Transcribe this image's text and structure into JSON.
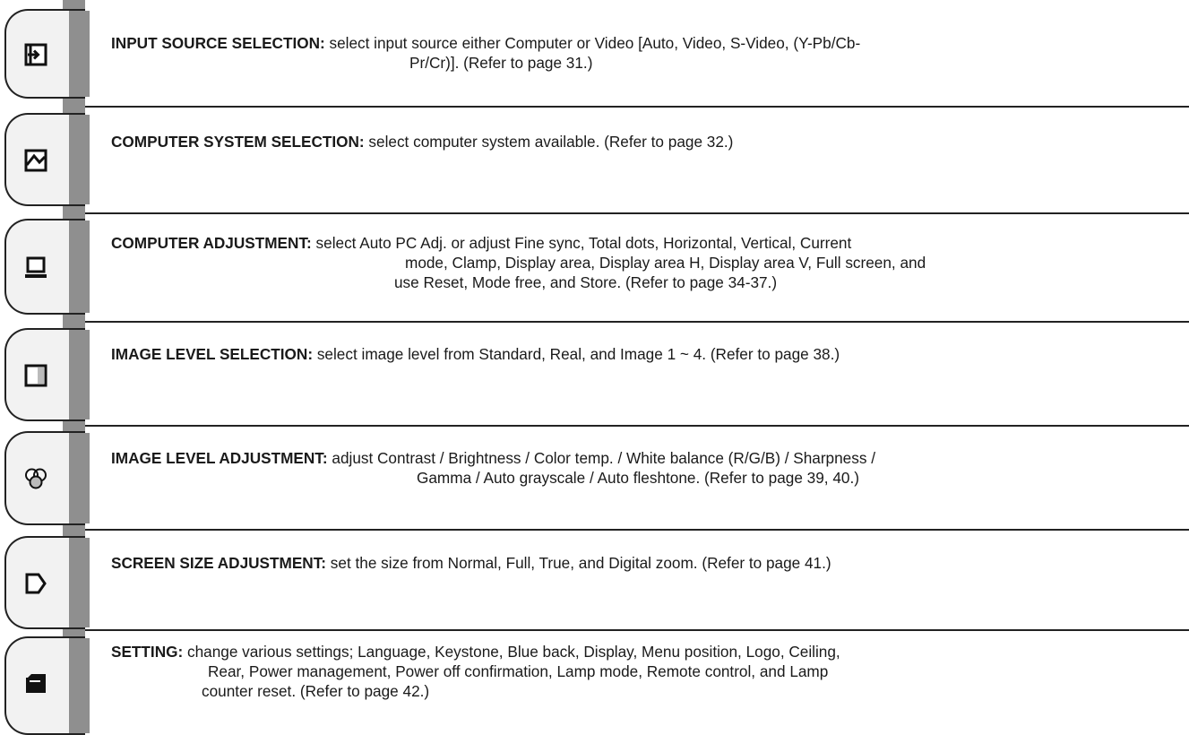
{
  "menu_items": [
    {
      "id": "input-source",
      "icon": "input-arrow-icon",
      "title": "INPUT SOURCE SELECTION:",
      "lines": [
        " select input source either Computer or Video [Auto, Video, S-Video, (Y-Pb/Cb-",
        "Pr/Cr)].  (Refer to page 31.)"
      ]
    },
    {
      "id": "computer-system",
      "icon": "signal-wave-icon",
      "title": "COMPUTER SYSTEM SELECTION:",
      "lines": [
        " select computer system available.  (Refer to page 32.)"
      ]
    },
    {
      "id": "computer-adjustment",
      "icon": "computer-monitor-icon",
      "title": "COMPUTER ADJUSTMENT:",
      "lines": [
        " select Auto PC Adj. or adjust Fine sync, Total dots, Horizontal, Vertical, Current",
        "mode, Clamp, Display area, Display area H, Display area V, Full screen, and",
        "use Reset, Mode free, and Store.  (Refer to page 34-37.)"
      ]
    },
    {
      "id": "image-level-selection",
      "icon": "image-level-icon",
      "title": "IMAGE LEVEL SELECTION:",
      "lines": [
        " select image level from Standard, Real, and Image 1 ~ 4.  (Refer to page 38.)"
      ]
    },
    {
      "id": "image-level-adjustment",
      "icon": "color-circles-icon",
      "title": "IMAGE LEVEL ADJUSTMENT:",
      "lines": [
        " adjust Contrast / Brightness / Color temp. / White balance (R/G/B) / Sharpness /",
        "Gamma / Auto grayscale / Auto fleshtone.  (Refer to page 39, 40.)"
      ]
    },
    {
      "id": "screen-size",
      "icon": "screen-size-icon",
      "title": "SCREEN SIZE ADJUSTMENT:",
      "lines": [
        " set the size from Normal, Full, True, and Digital zoom.  (Refer to page 41.)"
      ]
    },
    {
      "id": "setting",
      "icon": "settings-box-icon",
      "title": "SETTING:",
      "lines": [
        " change various settings; Language, Keystone, Blue back, Display, Menu position, Logo, Ceiling,",
        "Rear, Power management, Power off confirmation, Lamp mode, Remote control, and Lamp",
        "counter reset.  (Refer to page 42.)"
      ]
    }
  ]
}
